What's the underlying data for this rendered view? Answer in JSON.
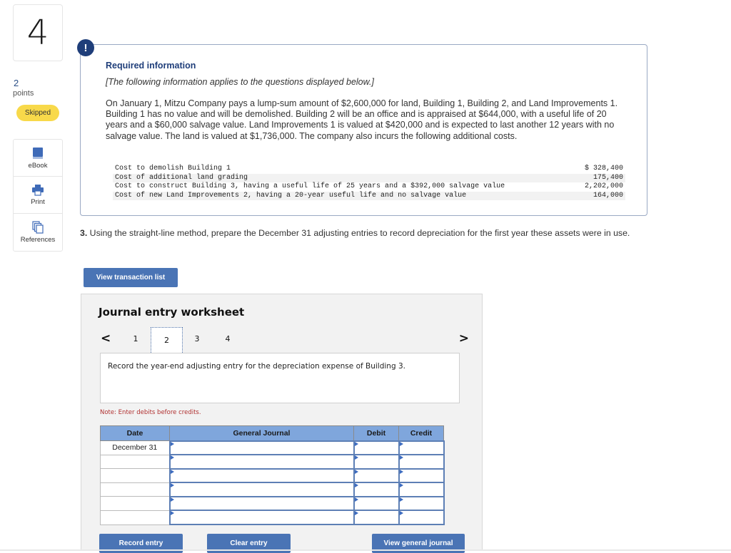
{
  "question": {
    "number": "4",
    "points_value": "2",
    "points_label": "points",
    "status": "Skipped"
  },
  "tools": [
    {
      "label": "eBook",
      "icon": "book-icon"
    },
    {
      "label": "Print",
      "icon": "printer-icon"
    },
    {
      "label": "References",
      "icon": "references-icon"
    }
  ],
  "required_info": {
    "alert_glyph": "!",
    "title": "Required information",
    "note": "[The following information applies to the questions displayed below.]",
    "paragraph": "On January 1, Mitzu Company pays a lump-sum amount of $2,600,000 for land, Building 1, Building 2, and Land Improvements 1. Building 1 has no value and will be demolished. Building 2 will be an office and is appraised at $644,000, with a useful life of 20 years and a $60,000 salvage value. Land Improvements 1 is valued at $420,000 and is expected to last another 12 years with no salvage value. The land is valued at $1,736,000. The company also incurs the following additional costs.",
    "costs": [
      {
        "description": "Cost to demolish Building 1",
        "amount": "$ 328,400"
      },
      {
        "description": "Cost of additional land grading",
        "amount": "175,400"
      },
      {
        "description": "Cost to construct Building 3, having a useful life of 25 years and a $392,000 salvage value",
        "amount": "2,202,000"
      },
      {
        "description": "Cost of new Land Improvements 2, having a 20-year useful life and no salvage value",
        "amount": "164,000"
      }
    ]
  },
  "part3": {
    "number": "3.",
    "text": " Using the straight-line method, prepare the December 31 adjusting entries to record depreciation for the first year these assets were in use."
  },
  "buttons": {
    "view_transaction_list": "View transaction list",
    "record_entry": "Record entry",
    "clear_entry": "Clear entry",
    "view_general_journal": "View general journal"
  },
  "worksheet": {
    "title": "Journal entry worksheet",
    "prev": "<",
    "next": ">",
    "pages": [
      "1",
      "2",
      "3",
      "4"
    ],
    "active_page": "2",
    "instruction": "Record the year-end adjusting entry for the depreciation expense of Building 3.",
    "note": "Note: Enter debits before credits.",
    "columns": [
      "Date",
      "General Journal",
      "Debit",
      "Credit"
    ],
    "rows": [
      {
        "date": "December 31",
        "account": "",
        "debit": "",
        "credit": ""
      },
      {
        "date": "",
        "account": "",
        "debit": "",
        "credit": ""
      },
      {
        "date": "",
        "account": "",
        "debit": "",
        "credit": ""
      },
      {
        "date": "",
        "account": "",
        "debit": "",
        "credit": ""
      },
      {
        "date": "",
        "account": "",
        "debit": "",
        "credit": ""
      },
      {
        "date": "",
        "account": "",
        "debit": "",
        "credit": ""
      }
    ]
  }
}
